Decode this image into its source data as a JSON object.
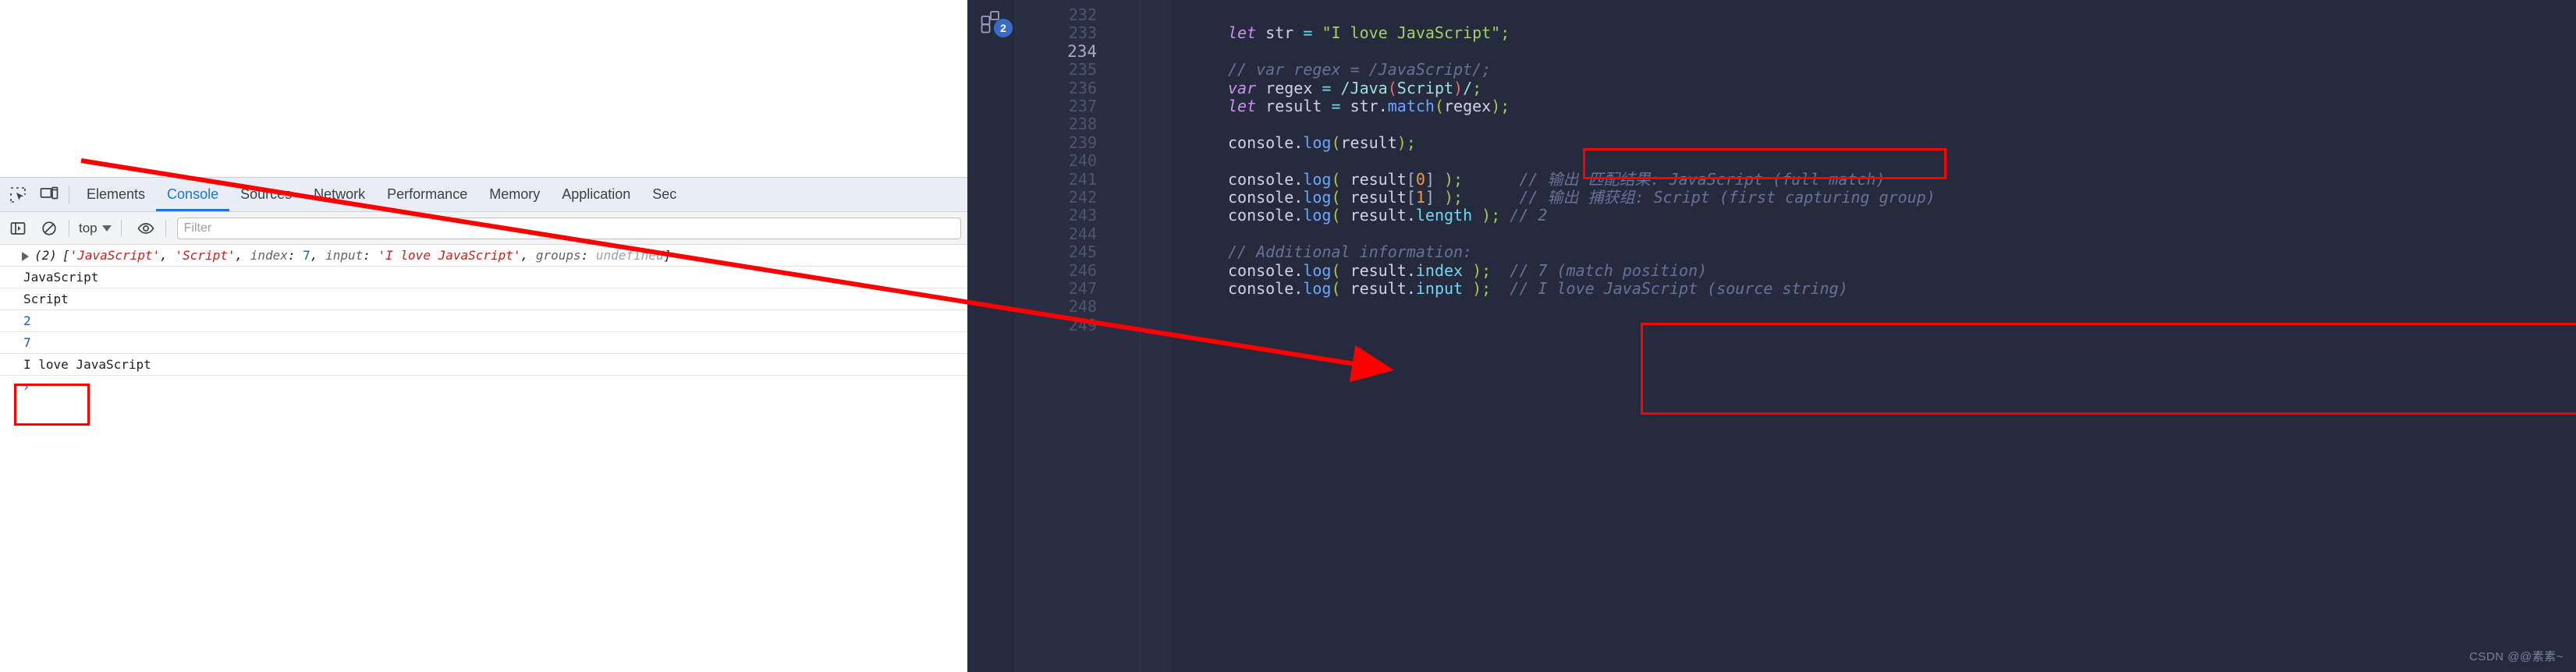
{
  "devtools": {
    "toolbar_icons": [
      {
        "name": "inspect-element-icon",
        "label": "Inspect element"
      },
      {
        "name": "device-toolbar-icon",
        "label": "Toggle device toolbar"
      }
    ],
    "tabs": [
      {
        "id": "elements",
        "label": "Elements",
        "active": false
      },
      {
        "id": "console",
        "label": "Console",
        "active": true
      },
      {
        "id": "sources",
        "label": "Sources",
        "active": false
      },
      {
        "id": "network",
        "label": "Network",
        "active": false
      },
      {
        "id": "performance",
        "label": "Performance",
        "active": false
      },
      {
        "id": "memory",
        "label": "Memory",
        "active": false
      },
      {
        "id": "application",
        "label": "Application",
        "active": false
      },
      {
        "id": "security",
        "label": "Sec",
        "active": false
      }
    ],
    "console_toolbar": {
      "sidebar_icon": "console-sidebar-icon",
      "clear_icon": "clear-console-icon",
      "context_value": "top",
      "eye_icon": "live-expression-eye-icon",
      "filter_placeholder": "Filter"
    },
    "console_rows": [
      {
        "type": "array",
        "count": "(2)",
        "parts": [
          {
            "t": "plain",
            "v": "[",
            "style": "tok-plain"
          },
          {
            "t": "string",
            "v": "'JavaScript'",
            "style": "tok-str"
          },
          {
            "t": "plain",
            "v": ", ",
            "style": "tok-plain"
          },
          {
            "t": "string",
            "v": "'Script'",
            "style": "tok-str"
          },
          {
            "t": "plain",
            "v": ", ",
            "style": "tok-plain"
          },
          {
            "t": "key",
            "v": "index",
            "style": "tok-key"
          },
          {
            "t": "plain",
            "v": ": ",
            "style": "tok-plain"
          },
          {
            "t": "num",
            "v": "7",
            "style": "tok-num"
          },
          {
            "t": "plain",
            "v": ", ",
            "style": "tok-plain"
          },
          {
            "t": "key",
            "v": "input",
            "style": "tok-key"
          },
          {
            "t": "plain",
            "v": ": ",
            "style": "tok-plain"
          },
          {
            "t": "string",
            "v": "'I love JavaScript'",
            "style": "tok-str"
          },
          {
            "t": "plain",
            "v": ", ",
            "style": "tok-plain"
          },
          {
            "t": "key",
            "v": "groups",
            "style": "tok-key"
          },
          {
            "t": "plain",
            "v": ": ",
            "style": "tok-plain"
          },
          {
            "t": "undef",
            "v": "undefined",
            "style": "tok-undef"
          },
          {
            "t": "plain",
            "v": "]",
            "style": "tok-plain"
          }
        ]
      },
      {
        "type": "text",
        "value": "JavaScript"
      },
      {
        "type": "text",
        "value": "Script"
      },
      {
        "type": "number",
        "value": "2"
      },
      {
        "type": "number",
        "value": "7"
      },
      {
        "type": "text",
        "value": "I love JavaScript"
      }
    ],
    "prompt_symbol": "›"
  },
  "editor": {
    "plugin_badge_count": "2",
    "bulb_line": "233",
    "lines": [
      {
        "n": "232",
        "current": false,
        "tokens": []
      },
      {
        "n": "233",
        "current": false,
        "bulb": true,
        "tokens": [
          {
            "c": "kw",
            "v": "let "
          },
          {
            "c": "plain",
            "v": "str "
          },
          {
            "c": "op",
            "v": "= "
          },
          {
            "c": "str",
            "v": "\"I love JavaScript\""
          },
          {
            "c": "semi",
            "v": ";"
          }
        ]
      },
      {
        "n": "234",
        "current": true,
        "tokens": []
      },
      {
        "n": "235",
        "current": false,
        "tokens": [
          {
            "c": "comment",
            "v": "// var regex = /JavaScript/;"
          }
        ]
      },
      {
        "n": "236",
        "current": false,
        "tokens": [
          {
            "c": "kw",
            "v": "var "
          },
          {
            "c": "plain",
            "v": "regex "
          },
          {
            "c": "op",
            "v": "= "
          },
          {
            "c": "regex",
            "v": "/Java"
          },
          {
            "c": "rgroup",
            "v": "("
          },
          {
            "c": "regex",
            "v": "Script"
          },
          {
            "c": "rgroup",
            "v": ")"
          },
          {
            "c": "regex",
            "v": "/"
          },
          {
            "c": "semi",
            "v": ";"
          }
        ]
      },
      {
        "n": "237",
        "current": false,
        "tokens": [
          {
            "c": "kw",
            "v": "let "
          },
          {
            "c": "plain",
            "v": "result "
          },
          {
            "c": "op",
            "v": "= "
          },
          {
            "c": "plain",
            "v": "str"
          },
          {
            "c": "dot",
            "v": "."
          },
          {
            "c": "fn",
            "v": "match"
          },
          {
            "c": "paren",
            "v": "("
          },
          {
            "c": "plain",
            "v": "regex"
          },
          {
            "c": "paren",
            "v": ")"
          },
          {
            "c": "semi",
            "v": ";"
          }
        ]
      },
      {
        "n": "238",
        "current": false,
        "tokens": []
      },
      {
        "n": "239",
        "current": false,
        "tokens": [
          {
            "c": "plain",
            "v": "console"
          },
          {
            "c": "dot",
            "v": "."
          },
          {
            "c": "fn",
            "v": "log"
          },
          {
            "c": "paren",
            "v": "("
          },
          {
            "c": "plain",
            "v": "result"
          },
          {
            "c": "paren",
            "v": ")"
          },
          {
            "c": "semi",
            "v": ";"
          }
        ]
      },
      {
        "n": "240",
        "current": false,
        "tokens": []
      },
      {
        "n": "241",
        "current": false,
        "tokens": [
          {
            "c": "plain",
            "v": "console"
          },
          {
            "c": "dot",
            "v": "."
          },
          {
            "c": "fn",
            "v": "log"
          },
          {
            "c": "paren",
            "v": "( "
          },
          {
            "c": "plain",
            "v": "result"
          },
          {
            "c": "punc",
            "v": "["
          },
          {
            "c": "num",
            "v": "0"
          },
          {
            "c": "punc",
            "v": "] "
          },
          {
            "c": "paren",
            "v": ")"
          },
          {
            "c": "semi",
            "v": ";"
          },
          {
            "c": "comment",
            "v": "      // 输出 匹配结果: JavaScript (full match)"
          }
        ]
      },
      {
        "n": "242",
        "current": false,
        "tokens": [
          {
            "c": "plain",
            "v": "console"
          },
          {
            "c": "dot",
            "v": "."
          },
          {
            "c": "fn",
            "v": "log"
          },
          {
            "c": "paren",
            "v": "( "
          },
          {
            "c": "plain",
            "v": "result"
          },
          {
            "c": "punc",
            "v": "["
          },
          {
            "c": "num",
            "v": "1"
          },
          {
            "c": "punc",
            "v": "] "
          },
          {
            "c": "paren",
            "v": ")"
          },
          {
            "c": "semi",
            "v": ";"
          },
          {
            "c": "comment",
            "v": "      // 输出 捕获组: Script (first capturing group)"
          }
        ]
      },
      {
        "n": "243",
        "current": false,
        "tokens": [
          {
            "c": "plain",
            "v": "console"
          },
          {
            "c": "dot",
            "v": "."
          },
          {
            "c": "fn",
            "v": "log"
          },
          {
            "c": "paren",
            "v": "( "
          },
          {
            "c": "plain",
            "v": "result"
          },
          {
            "c": "dot",
            "v": "."
          },
          {
            "c": "prop",
            "v": "length "
          },
          {
            "c": "paren",
            "v": ")"
          },
          {
            "c": "semi",
            "v": ";"
          },
          {
            "c": "comment",
            "v": " // 2"
          }
        ]
      },
      {
        "n": "244",
        "current": false,
        "tokens": []
      },
      {
        "n": "245",
        "current": false,
        "tokens": [
          {
            "c": "comment",
            "v": "// Additional information:"
          }
        ]
      },
      {
        "n": "246",
        "current": false,
        "tokens": [
          {
            "c": "plain",
            "v": "console"
          },
          {
            "c": "dot",
            "v": "."
          },
          {
            "c": "fn",
            "v": "log"
          },
          {
            "c": "paren",
            "v": "( "
          },
          {
            "c": "plain",
            "v": "result"
          },
          {
            "c": "dot",
            "v": "."
          },
          {
            "c": "prop",
            "v": "index "
          },
          {
            "c": "paren",
            "v": ")"
          },
          {
            "c": "semi",
            "v": ";"
          },
          {
            "c": "comment",
            "v": "  // 7 (match position)"
          }
        ]
      },
      {
        "n": "247",
        "current": false,
        "tokens": [
          {
            "c": "plain",
            "v": "console"
          },
          {
            "c": "dot",
            "v": "."
          },
          {
            "c": "fn",
            "v": "log"
          },
          {
            "c": "paren",
            "v": "( "
          },
          {
            "c": "plain",
            "v": "result"
          },
          {
            "c": "dot",
            "v": "."
          },
          {
            "c": "prop",
            "v": "input "
          },
          {
            "c": "paren",
            "v": ")"
          },
          {
            "c": "semi",
            "v": ";"
          },
          {
            "c": "comment",
            "v": "  // I love JavaScript (source string)"
          }
        ]
      },
      {
        "n": "248",
        "current": false,
        "tokens": []
      },
      {
        "n": "249",
        "current": false,
        "tokens": []
      }
    ],
    "watermark": "CSDN @@素素~"
  },
  "annotations": {
    "color": "#ff0000",
    "box_console_label": "highlighted console output: JavaScript / Script",
    "box_regex_label": "highlighted regex line 236",
    "box_logs_label": "highlighted console.log result[0] / result[1]",
    "arrow_label": "arrow from console output to code lines"
  }
}
